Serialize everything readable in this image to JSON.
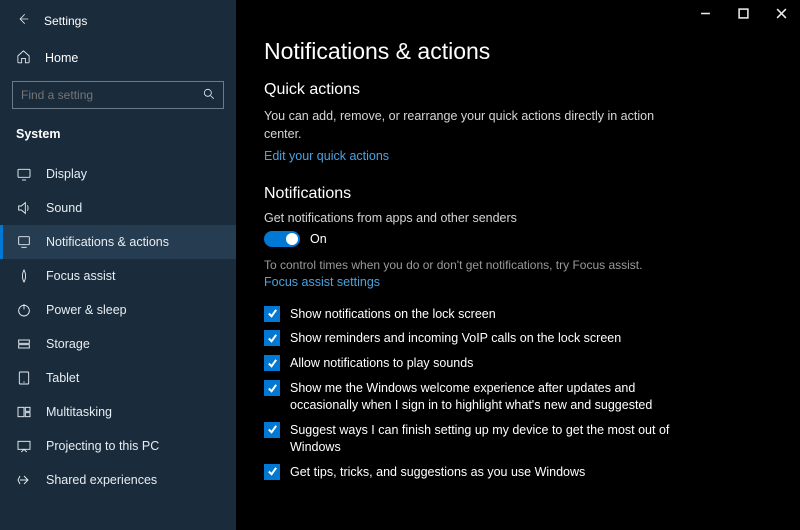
{
  "window": {
    "title": "Settings"
  },
  "sidebar": {
    "home": "Home",
    "search_placeholder": "Find a setting",
    "category": "System",
    "items": [
      {
        "label": "Display"
      },
      {
        "label": "Sound"
      },
      {
        "label": "Notifications & actions"
      },
      {
        "label": "Focus assist"
      },
      {
        "label": "Power & sleep"
      },
      {
        "label": "Storage"
      },
      {
        "label": "Tablet"
      },
      {
        "label": "Multitasking"
      },
      {
        "label": "Projecting to this PC"
      },
      {
        "label": "Shared experiences"
      }
    ]
  },
  "page": {
    "title": "Notifications & actions",
    "quick": {
      "heading": "Quick actions",
      "desc": "You can add, remove, or rearrange your quick actions directly in action center.",
      "link": "Edit your quick actions"
    },
    "notif": {
      "heading": "Notifications",
      "sub": "Get notifications from apps and other senders",
      "toggle_state": "On",
      "note": "To control times when you do or don't get notifications, try Focus assist.",
      "note_link": "Focus assist settings",
      "checks": [
        "Show notifications on the lock screen",
        "Show reminders and incoming VoIP calls on the lock screen",
        "Allow notifications to play sounds",
        "Show me the Windows welcome experience after updates and occasionally when I sign in to highlight what's new and suggested",
        "Suggest ways I can finish setting up my device to get the most out of Windows",
        "Get tips, tricks, and suggestions as you use Windows"
      ]
    }
  }
}
